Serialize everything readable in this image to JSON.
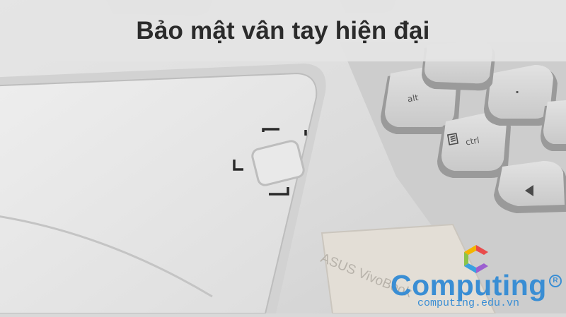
{
  "banner": {
    "title": "Bảo mật vân tay hiện đại"
  },
  "keys": {
    "alt": "alt",
    "ctrl": "ctrl",
    "period": "."
  },
  "laptop": {
    "brand": "ASUS VivoBook"
  },
  "watermark": {
    "word": "Computing",
    "url": "computing.edu.vn",
    "registered": "R",
    "color": "#3a8ed4"
  },
  "icons": [
    "fingerprint-sensor-icon",
    "menu-key-icon",
    "arrow-left-icon",
    "computing-logo-icon"
  ]
}
